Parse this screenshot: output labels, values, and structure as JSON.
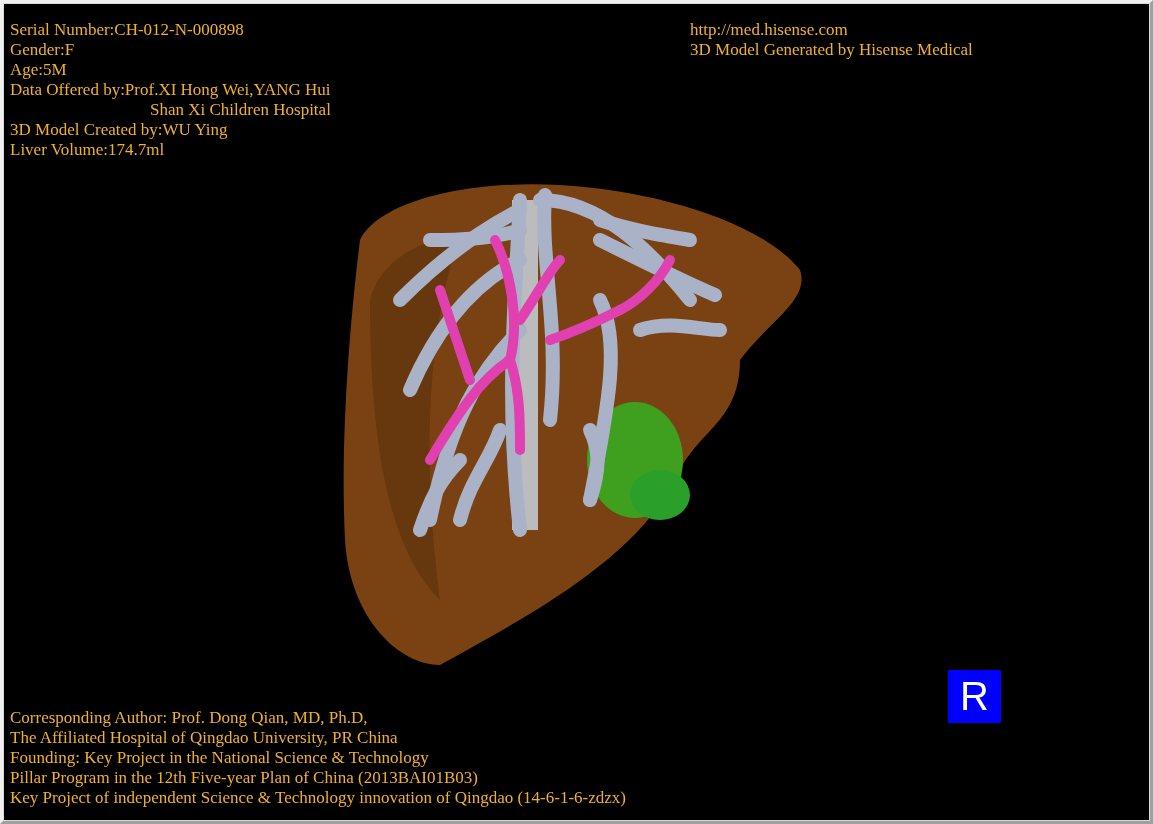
{
  "info_top_left": [
    {
      "text": "Serial Number:CH-012-N-000898",
      "kind": "line"
    },
    {
      "text": "Gender:F",
      "kind": "line"
    },
    {
      "text": "Age:5M",
      "kind": "line"
    },
    {
      "text": "Data Offered by:Prof.XI Hong Wei,YANG Hui",
      "kind": "line"
    },
    {
      "text": "Shan Xi Children Hospital",
      "kind": "continuation"
    },
    {
      "text": "3D Model Created by:WU Ying",
      "kind": "line"
    },
    {
      "text": "Liver Volume:174.7ml",
      "kind": "line"
    }
  ],
  "info_top_right": [
    "http://med.hisense.com",
    "3D Model Generated by Hisense Medical"
  ],
  "orientation_marker": "R",
  "credits": [
    "Corresponding Author: Prof. Dong Qian, MD, Ph.D,",
    "The Affiliated Hospital of Qingdao University, PR China",
    "Founding: Key Project in the National Science & Technology",
    "Pillar Program in the 12th Five-year Plan of China (2013BAI01B03)",
    "Key Project of independent Science & Technology innovation of Qingdao (14-6-1-6-zdzx)"
  ]
}
